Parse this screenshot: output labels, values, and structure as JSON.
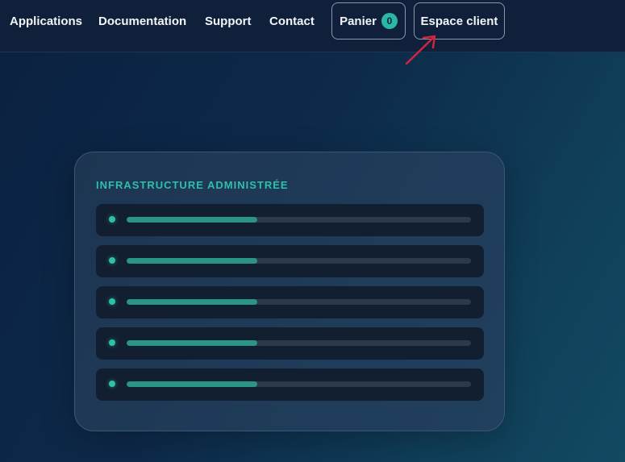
{
  "nav": {
    "links": [
      "Applications",
      "Documentation",
      "Support",
      "Contact"
    ],
    "cart_label": "Panier",
    "cart_count": "0",
    "client_label": "Espace client"
  },
  "card": {
    "title": "INFRASTRUCTURE ADMINISTRÉE",
    "rows": [
      {
        "progress": 0.38
      },
      {
        "progress": 0.38
      },
      {
        "progress": 0.38
      },
      {
        "progress": 0.38
      },
      {
        "progress": 0.38
      }
    ]
  },
  "colors": {
    "accent": "#2fbfaa",
    "arrow": "#d0253f",
    "background": "#0d2a4a"
  },
  "icons": {
    "annotation": "red-arrow-icon",
    "row_marker": "status-dot-icon"
  }
}
